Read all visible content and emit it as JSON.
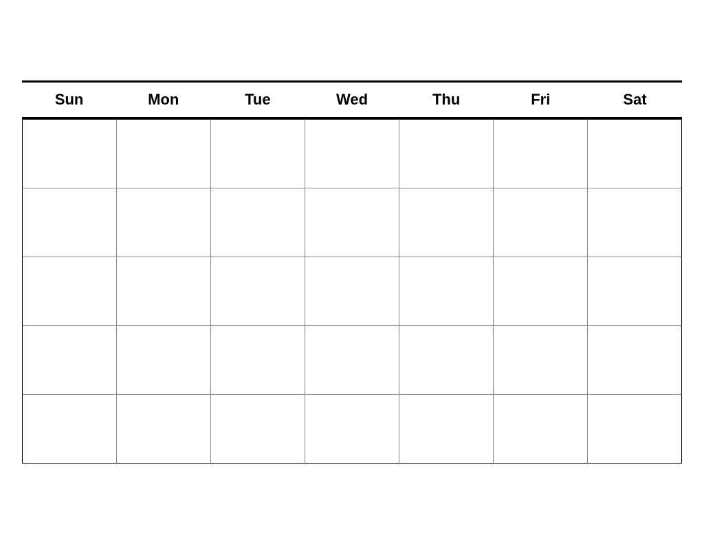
{
  "calendar": {
    "days": [
      {
        "id": "sun",
        "label": "Sun"
      },
      {
        "id": "mon",
        "label": "Mon"
      },
      {
        "id": "tue",
        "label": "Tue"
      },
      {
        "id": "wed",
        "label": "Wed"
      },
      {
        "id": "thu",
        "label": "Thu"
      },
      {
        "id": "fri",
        "label": "Fri"
      },
      {
        "id": "sat",
        "label": "Sat"
      }
    ],
    "rows": 5,
    "cols": 7
  }
}
